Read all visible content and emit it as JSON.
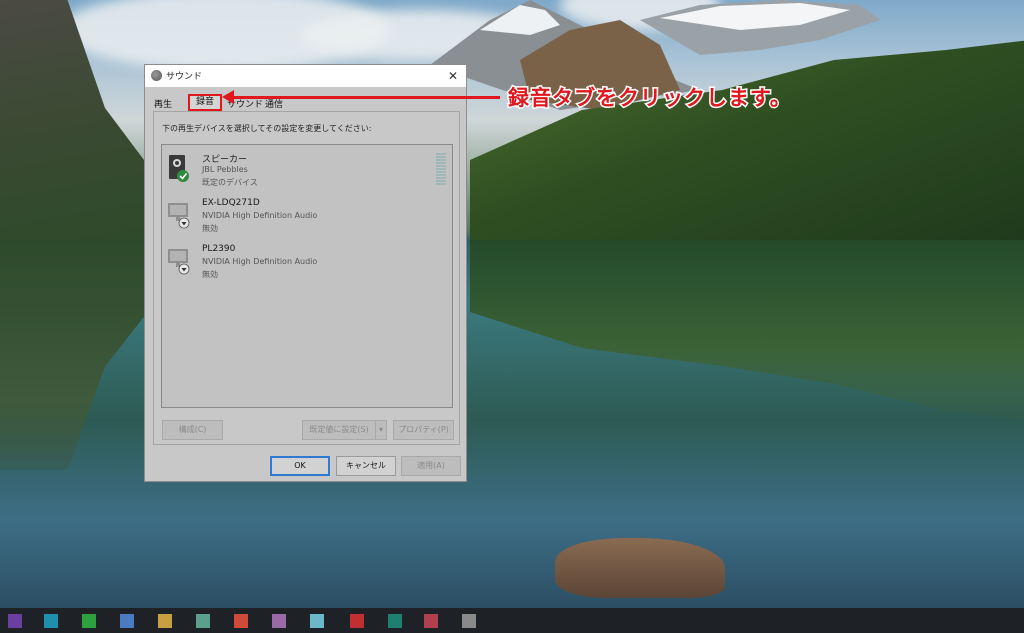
{
  "dialog": {
    "title": "サウンド",
    "close_glyph": "✕",
    "tabs": [
      {
        "label": "再生"
      },
      {
        "label": "録音"
      },
      {
        "label": "サウンド"
      },
      {
        "label": "通信"
      }
    ],
    "instruction": "下の再生デバイスを選択してその設定を変更してください:",
    "devices": [
      {
        "name": "スピーカー",
        "description": "JBL Pebbles",
        "status": "既定のデバイス"
      },
      {
        "name": "EX-LDQ271D",
        "description": "NVIDIA High Definition Audio",
        "status": "無効"
      },
      {
        "name": "PL2390",
        "description": "NVIDIA High Definition Audio",
        "status": "無効"
      }
    ],
    "buttons": {
      "configure": "構成(C)",
      "set_default": "既定値に設定(S)",
      "set_default_arrow": "▾",
      "properties": "プロパティ(P)",
      "ok": "OK",
      "cancel": "キャンセル",
      "apply": "適用(A)"
    }
  },
  "annotation": {
    "callout": "録音タブをクリックします。",
    "color": "#e0171d"
  }
}
